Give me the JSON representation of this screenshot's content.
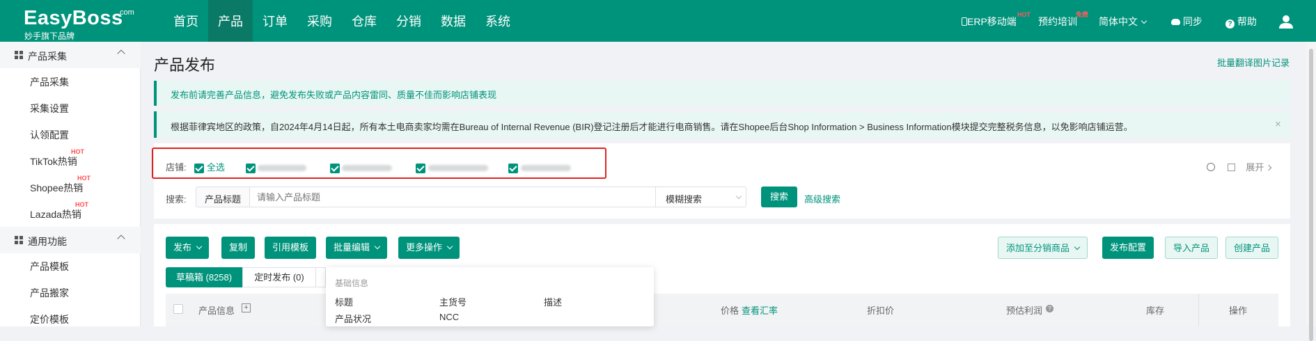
{
  "app": {
    "logo_text": "EasyBoss",
    "logo_suffix": ".com",
    "logo_slogan": "妙手旗下品牌",
    "nav": [
      "首页",
      "产品",
      "订单",
      "采购",
      "仓库",
      "分销",
      "数据",
      "系统"
    ],
    "active_nav": "产品",
    "right_items": {
      "mobile": "ERP移动端",
      "mobile_badge": "HOT",
      "training": "预约培训",
      "training_badge": "免费",
      "language": "简体中文",
      "sync": "同步",
      "help": "帮助"
    },
    "brand_color": "#00937b"
  },
  "sidebar": {
    "groups": [
      {
        "label": "产品采集",
        "items": [
          {
            "label": "产品采集"
          },
          {
            "label": "采集设置"
          },
          {
            "label": "认领配置"
          },
          {
            "label": "TikTok热销",
            "badge": "HOT"
          },
          {
            "label": "Shopee热销",
            "badge": "HOT"
          },
          {
            "label": "Lazada热销",
            "badge": "HOT"
          }
        ]
      },
      {
        "label": "通用功能",
        "items": [
          {
            "label": "产品模板"
          },
          {
            "label": "产品搬家"
          },
          {
            "label": "定价模板"
          }
        ]
      }
    ]
  },
  "page": {
    "title": "产品发布",
    "translate_log": "批量翻译图片记录",
    "notice1": "发布前请完善产品信息，避免发布失败或产品内容雷同、质量不佳而影响店铺表现",
    "notice2": "根据菲律宾地区的政策，自2024年4月14日起，所有本土电商卖家均需在Bureau of Internal Revenue (BIR)登记注册后才能进行电商销售。请在Shopee后台Shop Information > Business Information模块提交完整税务信息，以免影响店铺运营。",
    "notice_close": "×"
  },
  "filter": {
    "store_label": "店铺:",
    "select_all": "全选",
    "expand": "展开",
    "search_label": "搜索:",
    "search_field": "产品标题",
    "search_placeholder": "请输入产品标题",
    "match_mode": "模糊搜索",
    "search_button": "搜索",
    "advanced": "高级搜索"
  },
  "toolbar": {
    "publish": "发布",
    "copy": "复制",
    "template": "引用模板",
    "batch_edit": "批量编辑",
    "more": "更多操作",
    "add_distribution": "添加至分销商品",
    "publish_config": "发布配置",
    "import": "导入产品",
    "create": "创建产品"
  },
  "tabs": {
    "draft": "草稿箱 (8258)",
    "scheduled": "定时发布 (0)"
  },
  "table": {
    "product_info": "产品信息",
    "price": "价格",
    "view_rate": "查看汇率",
    "discount": "折扣价",
    "profit": "预估利润",
    "stock": "库存",
    "action": "操作"
  },
  "popup": {
    "section": "基础信息",
    "items": [
      "标题",
      "主货号",
      "描述",
      "产品状况",
      "NCC"
    ]
  }
}
